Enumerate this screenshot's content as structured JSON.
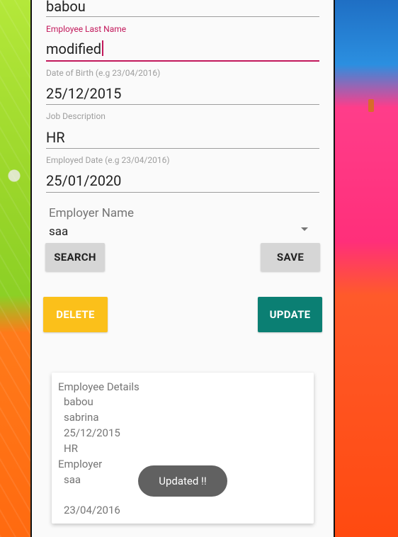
{
  "form": {
    "first_name_value": "babou",
    "last_name_label": "Employee Last Name",
    "last_name_value": "modified",
    "dob_label": "Date of Birth (e.g 23/04/2016)",
    "dob_value": "25/12/2015",
    "job_label": "Job Description",
    "job_value": "HR",
    "employed_label": "Employed Date (e.g 23/04/2016)",
    "employed_value": "25/01/2020",
    "employer_label": "Employer Name",
    "employer_value": "saa"
  },
  "buttons": {
    "search": "SEARCH",
    "save": "SAVE",
    "delete": "DELETE",
    "update": "UPDATE"
  },
  "details": {
    "title": "Employee Details",
    "first_name": "babou",
    "last_name": "sabrina",
    "dob": "25/12/2015",
    "job": "HR",
    "employer_heading": "Employer",
    "employer_name": "saa",
    "employer_date": "23/04/2016"
  },
  "toast": "Updated !!",
  "colors": {
    "accent": "#c2185b",
    "delete": "#fbc01a",
    "update": "#0b7f73",
    "toast": "#616161"
  }
}
